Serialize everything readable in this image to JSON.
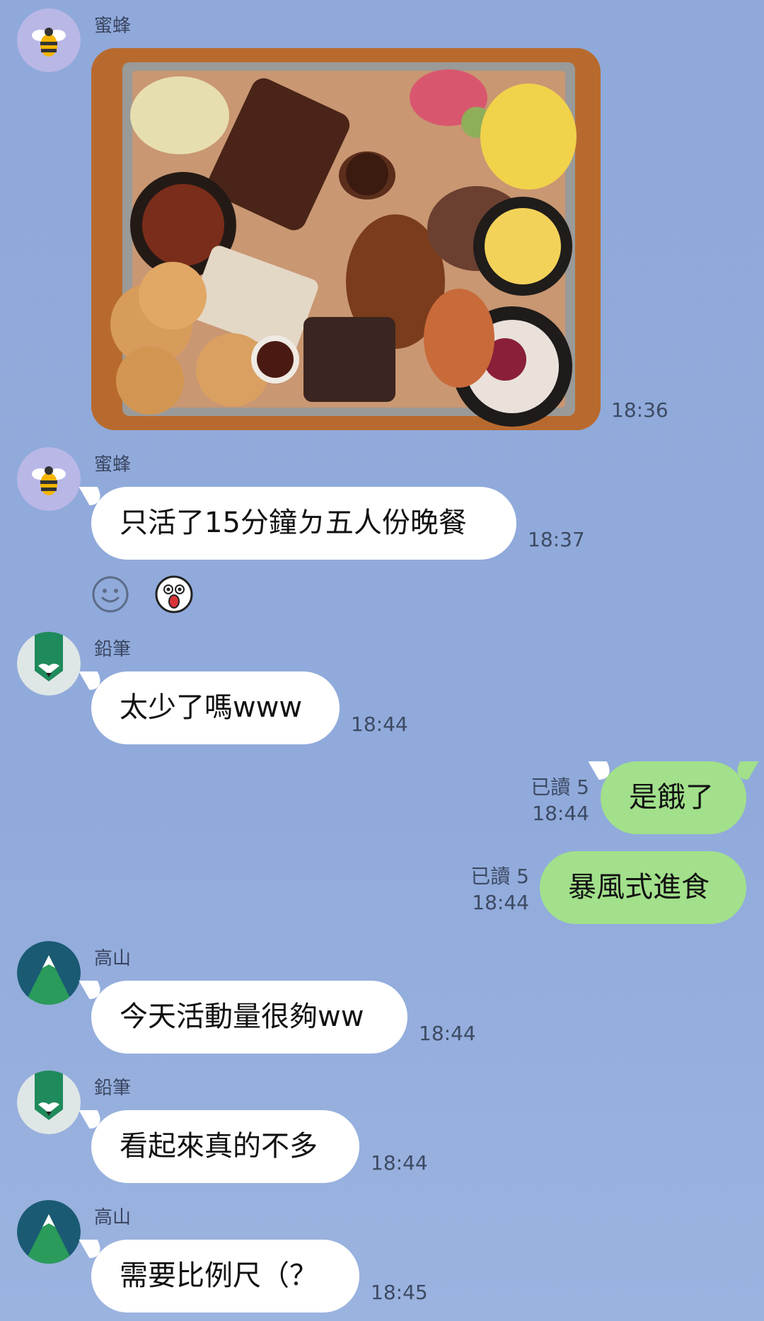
{
  "messages": [
    {
      "sender": "蜜蜂",
      "type": "image",
      "time": "18:36",
      "image_alt": "BBQ platter"
    },
    {
      "sender": "蜜蜂",
      "type": "text",
      "text": "只活了15分鐘ㄉ五人份晚餐",
      "time": "18:37"
    },
    {
      "sender": "鉛筆",
      "type": "text",
      "text": "太少了嗎www",
      "time": "18:44"
    },
    {
      "sender": "me",
      "type": "text",
      "text": "是餓了",
      "time": "18:44",
      "read": "已讀 5"
    },
    {
      "sender": "me",
      "type": "text",
      "text": "暴風式進食",
      "time": "18:44",
      "read": "已讀 5"
    },
    {
      "sender": "高山",
      "type": "text",
      "text": "今天活動量很夠ww",
      "time": "18:44"
    },
    {
      "sender": "鉛筆",
      "type": "text",
      "text": "看起來真的不多",
      "time": "18:44"
    },
    {
      "sender": "高山",
      "type": "text",
      "text": "需要比例尺（？",
      "time": "18:45"
    }
  ],
  "reactions": [
    {
      "icon": "smiley-add-icon"
    },
    {
      "icon": "surprised-face-sticker-icon"
    }
  ],
  "colors": {
    "background": "#8fa9da",
    "incoming_bubble": "#ffffff",
    "outgoing_bubble": "#a2e08b"
  }
}
